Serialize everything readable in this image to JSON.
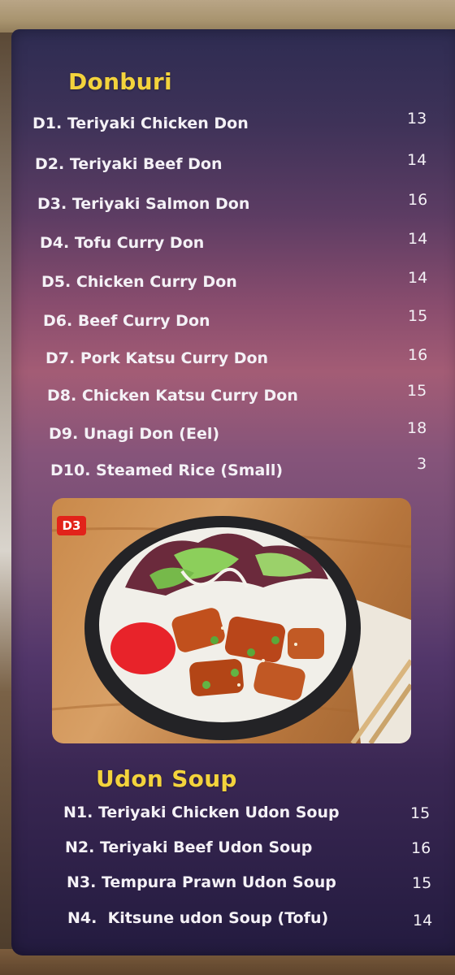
{
  "donburi": {
    "title": "Donburi",
    "items": [
      {
        "name": "D1. Teriyaki Chicken Don",
        "price": "13"
      },
      {
        "name": "D2. Teriyaki Beef Don",
        "price": "14"
      },
      {
        "name": "D3. Teriyaki Salmon Don",
        "price": "16"
      },
      {
        "name": "D4. Tofu Curry Don",
        "price": "14"
      },
      {
        "name": "D5. Chicken Curry Don",
        "price": "14"
      },
      {
        "name": "D6. Beef Curry Don",
        "price": "15"
      },
      {
        "name": "D7. Pork Katsu Curry Don",
        "price": "16"
      },
      {
        "name": "D8. Chicken Katsu Curry Don",
        "price": "15"
      },
      {
        "name": "D9. Unagi Don (Eel)",
        "price": "18"
      },
      {
        "name": "D10. Steamed Rice (Small)",
        "price": "3"
      }
    ]
  },
  "photo": {
    "badge": "D3"
  },
  "udon_soup": {
    "title": "Udon Soup",
    "items": [
      {
        "name": "N1. Teriyaki Chicken Udon Soup",
        "price": "15"
      },
      {
        "name": "N2. Teriyaki Beef Udon Soup",
        "price": "16"
      },
      {
        "name": "N3. Tempura Prawn Udon Soup",
        "price": "15"
      },
      {
        "name": "N4.  Kitsune udon Soup (Tofu)",
        "price": "14"
      }
    ]
  },
  "colors": {
    "title_yellow": "#f3d33c",
    "item_text": "#f4f1f6",
    "badge_red": "#e2231a"
  }
}
